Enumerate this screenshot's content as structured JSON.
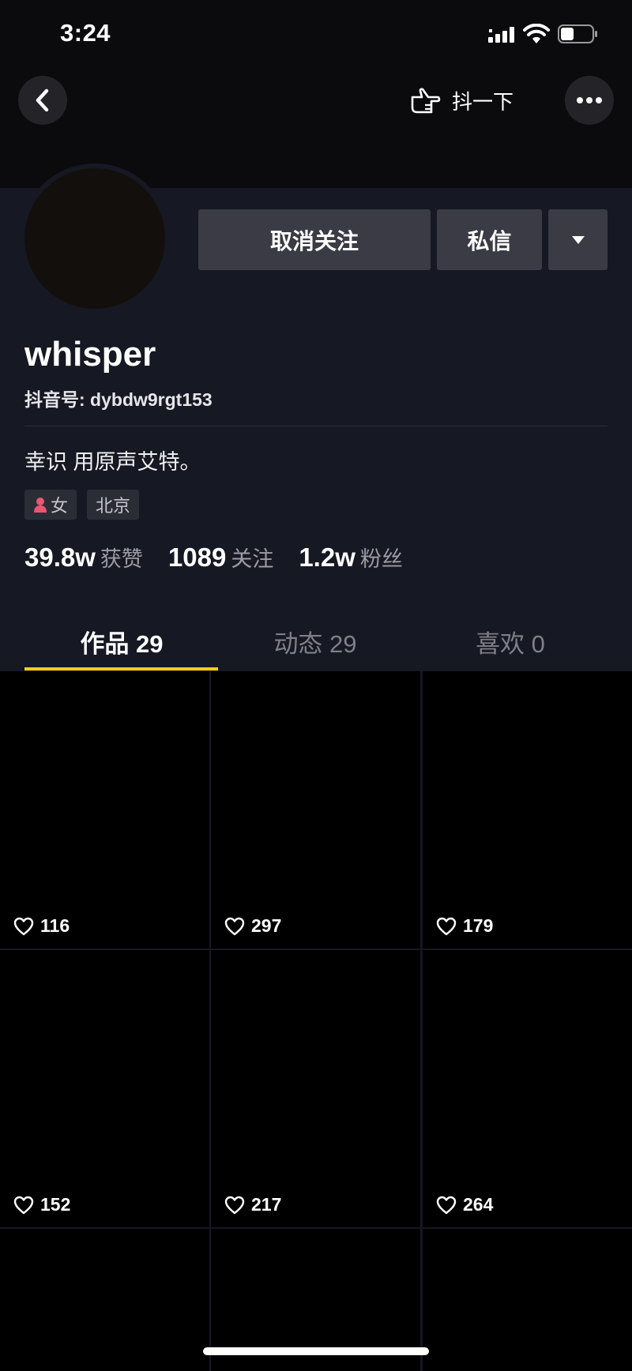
{
  "status_bar": {
    "time": "3:24"
  },
  "nav": {
    "shake_label": "抖一下"
  },
  "actions": {
    "unfollow_label": "取消关注",
    "message_label": "私信"
  },
  "profile": {
    "username": "whisper",
    "account_id": "抖音号: dybdw9rgt153",
    "bio": "幸识 用原声艾特。",
    "tags": {
      "gender": "女",
      "location": "北京"
    },
    "stats": [
      {
        "value": "39.8w",
        "label": "获赞"
      },
      {
        "value": "1089",
        "label": "关注"
      },
      {
        "value": "1.2w",
        "label": "粉丝"
      }
    ]
  },
  "tabs": [
    {
      "label": "作品 29",
      "active": true
    },
    {
      "label": "动态 29",
      "active": false
    },
    {
      "label": "喜欢 0",
      "active": false
    }
  ],
  "videos": [
    {
      "likes": "116"
    },
    {
      "likes": "297"
    },
    {
      "likes": "179"
    },
    {
      "likes": "152"
    },
    {
      "likes": "217"
    },
    {
      "likes": "264"
    },
    {
      "likes": ""
    },
    {
      "likes": ""
    },
    {
      "likes": ""
    }
  ],
  "colors": {
    "background": "#161823",
    "accent": "#face15",
    "button": "#3a3b44"
  }
}
